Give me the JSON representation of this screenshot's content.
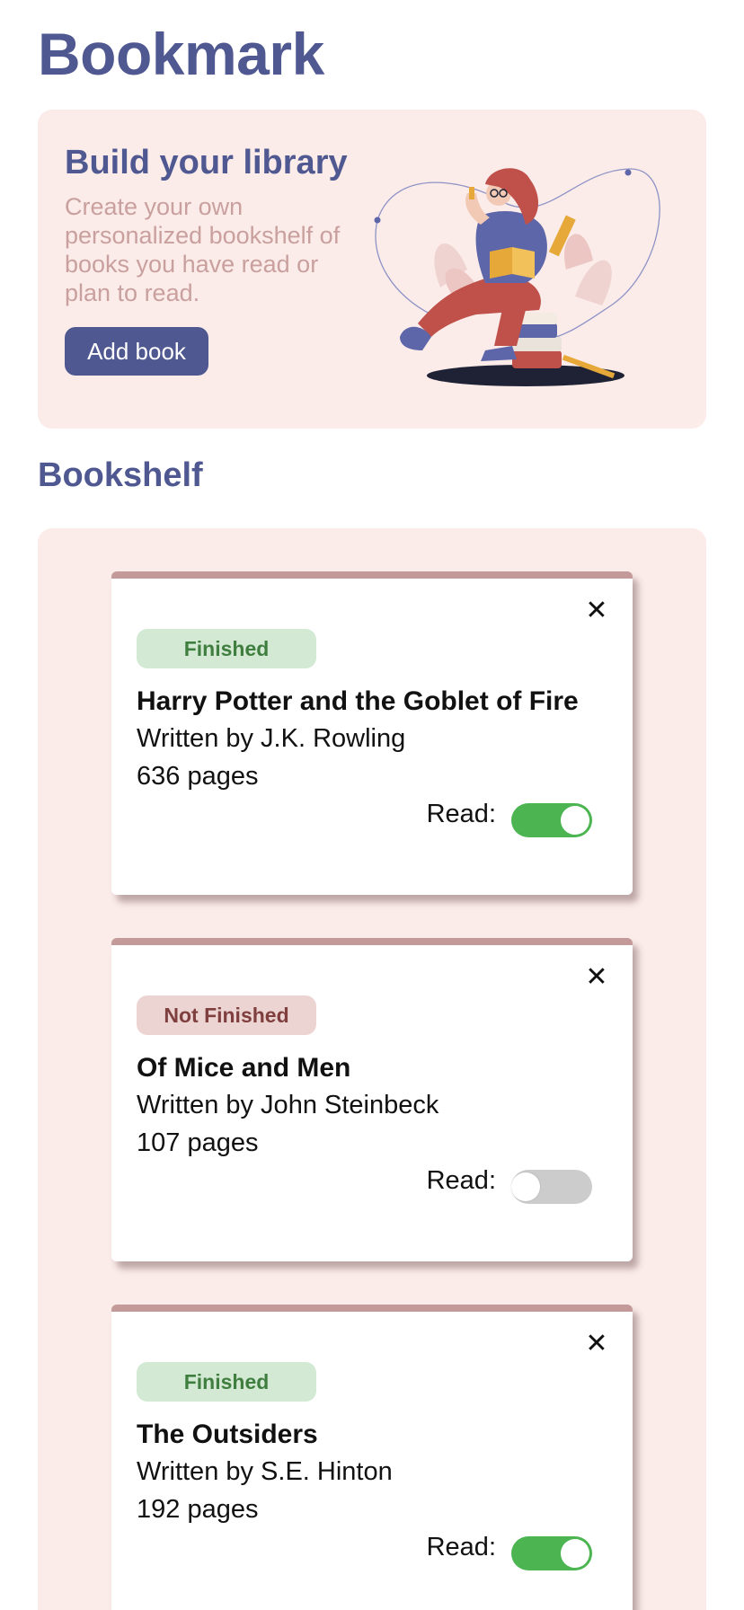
{
  "app": {
    "title": "Bookmark"
  },
  "hero": {
    "title": "Build your library",
    "description": "Create your own personalized bookshelf of books you have read or plan to read.",
    "add_button_label": "Add book"
  },
  "bookshelf": {
    "title": "Bookshelf",
    "read_label": "Read:",
    "close_symbol": "✕",
    "books": [
      {
        "status": "Finished",
        "title": "Harry Potter and the Goblet of Fire",
        "author_line": "Written by J.K. Rowling",
        "pages_line": "636 pages",
        "read": true
      },
      {
        "status": "Not Finished",
        "title": "Of Mice and Men",
        "author_line": "Written by John Steinbeck",
        "pages_line": "107 pages",
        "read": false
      },
      {
        "status": "Finished",
        "title": "The Outsiders",
        "author_line": "Written by S.E. Hinton",
        "pages_line": "192 pages",
        "read": true
      }
    ]
  },
  "colors": {
    "accent": "#4f5890",
    "panel": "#fbecea",
    "card_border": "#c39a99",
    "toggle_on": "#4cb552",
    "toggle_off": "#cccccc",
    "finished_bg": "#d3e9d3",
    "finished_text": "#3f7e3f",
    "not_finished_bg": "#ecd4d2",
    "not_finished_text": "#7f3f3e"
  }
}
